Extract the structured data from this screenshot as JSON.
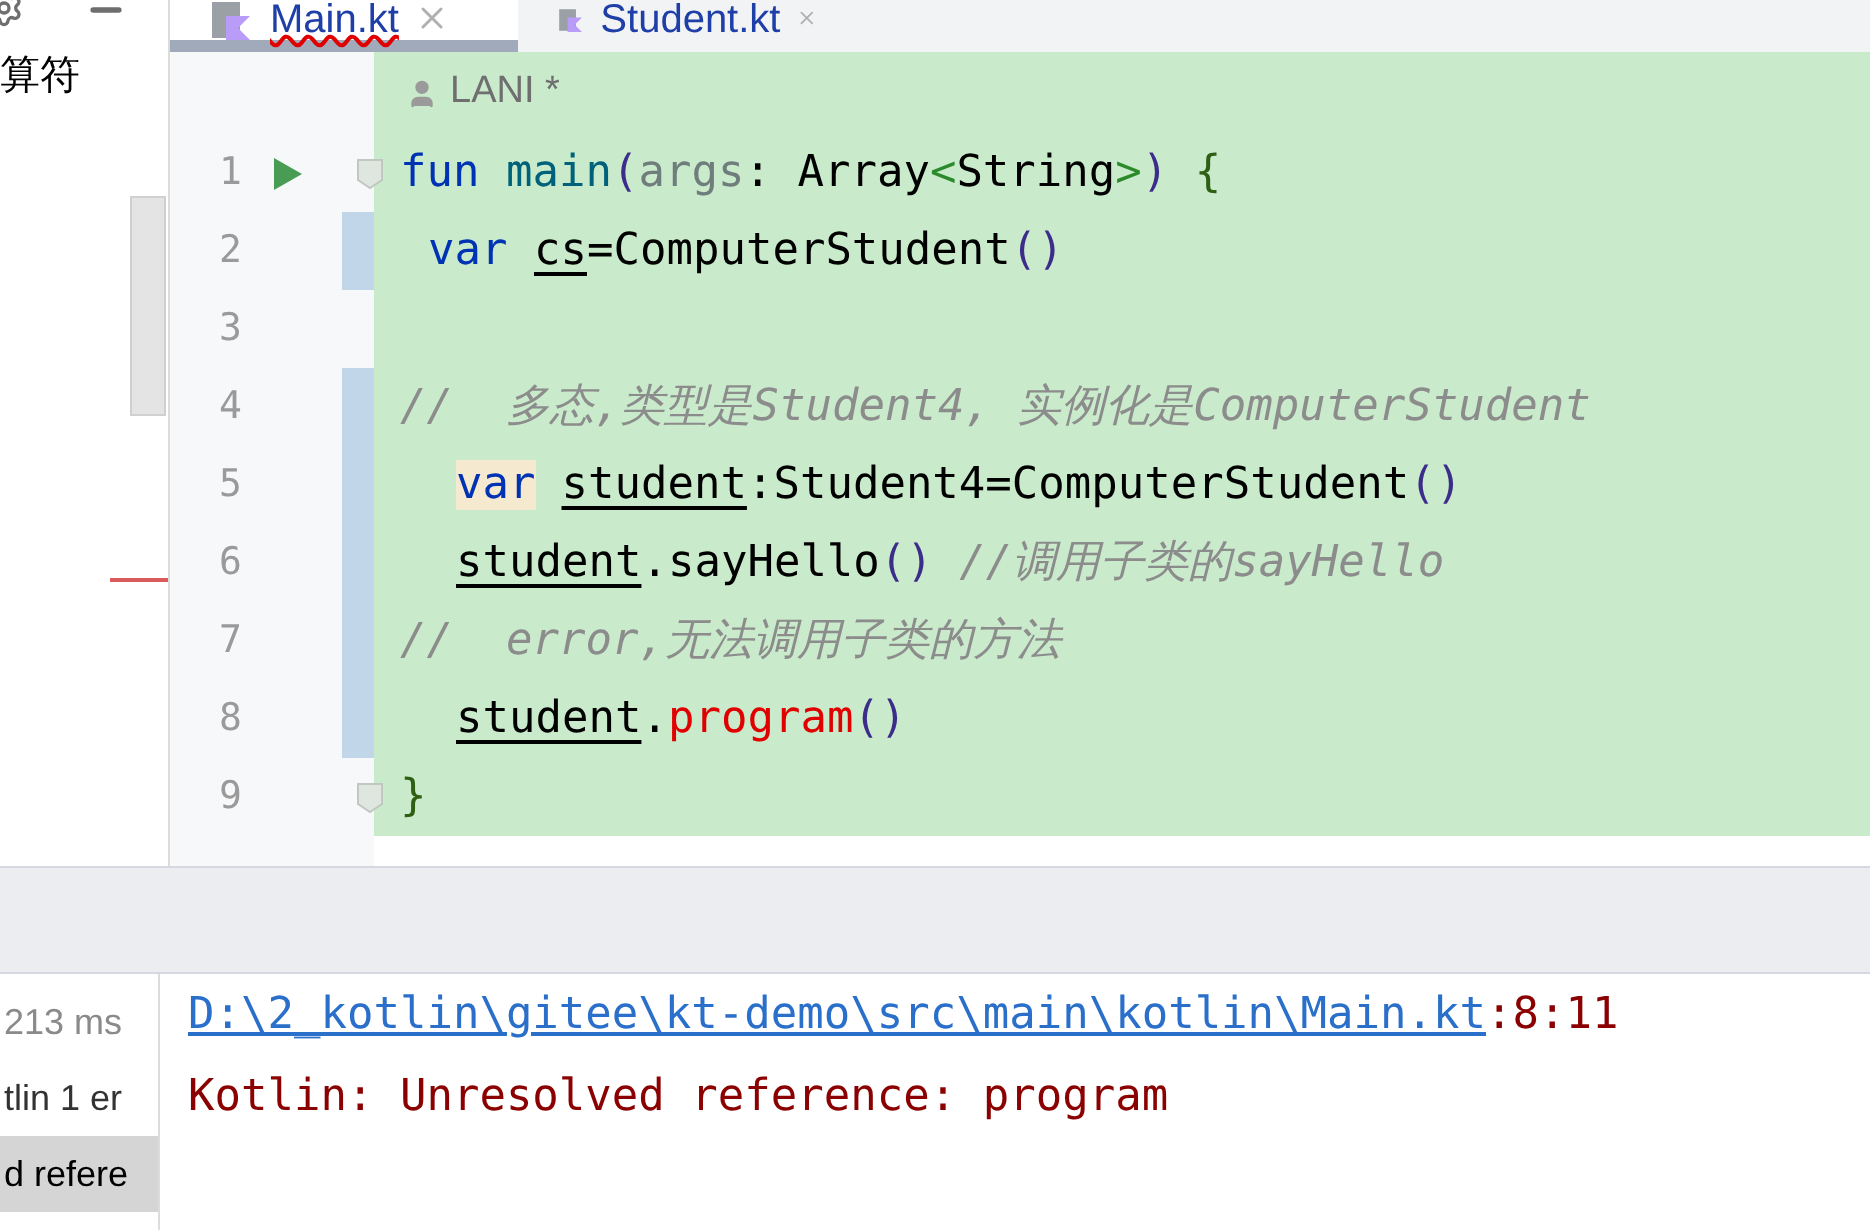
{
  "side_panel": {
    "text": "算符"
  },
  "tabs": [
    {
      "label": "Main.kt",
      "selected": true,
      "error": true
    },
    {
      "label": "Student.kt",
      "selected": false,
      "error": false
    }
  ],
  "author_hint": "LANI *",
  "lines": [
    {
      "number": "1",
      "kind": "flush",
      "run": true,
      "fold": true,
      "changed": false,
      "segments": [
        {
          "text": "fun",
          "kind": "keyword"
        },
        {
          "text": " main",
          "kind": "function"
        },
        {
          "text": "(",
          "kind": "bracket"
        },
        {
          "text": "args",
          "kind": "param"
        },
        {
          "text": ": Array",
          "kind": "plain"
        },
        {
          "text": "<",
          "kind": "angle"
        },
        {
          "text": "String",
          "kind": "plain"
        },
        {
          "text": ">",
          "kind": "angle"
        },
        {
          "text": ")",
          "kind": "bracket"
        },
        {
          "text": " {",
          "kind": "brace"
        }
      ]
    },
    {
      "number": "2",
      "kind": "shallow",
      "run": false,
      "fold": false,
      "changed": true,
      "segments": [
        {
          "text": "var ",
          "kind": "keyword"
        },
        {
          "text": "cs",
          "kind": "variable"
        },
        {
          "text": "=ComputerStudent",
          "kind": "plain"
        },
        {
          "text": "()",
          "kind": "bracket"
        }
      ]
    },
    {
      "number": "3",
      "kind": "flush",
      "run": false,
      "fold": false,
      "changed": false
    },
    {
      "number": "4",
      "kind": "flush",
      "run": false,
      "fold": false,
      "changed": true,
      "segments": [
        {
          "text": "//  多态,类型是Student4, 实例化是ComputerStudent",
          "kind": "comment"
        }
      ]
    },
    {
      "number": "5",
      "kind": "nested",
      "run": false,
      "fold": false,
      "changed": true,
      "segments": [
        {
          "text": "var",
          "kind": "keyword-marked"
        },
        {
          "text": "student",
          "kind": "gapvariable"
        },
        {
          "text": ":Student4=ComputerStudent",
          "kind": "plain"
        },
        {
          "text": "()",
          "kind": "bracket"
        }
      ]
    },
    {
      "number": "6",
      "kind": "nested",
      "run": false,
      "fold": false,
      "changed": true,
      "segments": [
        {
          "text": "student",
          "kind": "variable"
        },
        {
          "text": ".sayHello",
          "kind": "plain"
        },
        {
          "text": "()",
          "kind": "bracket"
        },
        {
          "text": " //调用子类的sayHello",
          "kind": "comment"
        }
      ]
    },
    {
      "number": "7",
      "kind": "flush",
      "run": false,
      "fold": false,
      "changed": true,
      "segments": [
        {
          "text": "//  error,无法调用子类的方法",
          "kind": "comment"
        }
      ]
    },
    {
      "number": "8",
      "kind": "nested",
      "run": false,
      "fold": false,
      "changed": true,
      "segments": [
        {
          "text": "student",
          "kind": "variable"
        },
        {
          "text": ".",
          "kind": "plain"
        },
        {
          "text": "program",
          "kind": "error"
        },
        {
          "text": "()",
          "kind": "bracket"
        }
      ]
    },
    {
      "number": "9",
      "kind": "flush",
      "run": false,
      "fold": true,
      "changed": false,
      "segments": [
        {
          "text": "}",
          "kind": "brace"
        }
      ]
    }
  ],
  "build_tree": [
    {
      "label": "213 ms",
      "kind": "time",
      "selected": false
    },
    {
      "label": "tlin 1 er",
      "kind": "node",
      "selected": false
    },
    {
      "label": "d refere",
      "kind": "node",
      "selected": true
    }
  ],
  "message": {
    "path": "D:\\2_kotlin\\gitee\\kt-demo\\src\\main\\kotlin\\Main.kt",
    "position": ":8:11",
    "text": "Kotlin: Unresolved reference: program"
  }
}
